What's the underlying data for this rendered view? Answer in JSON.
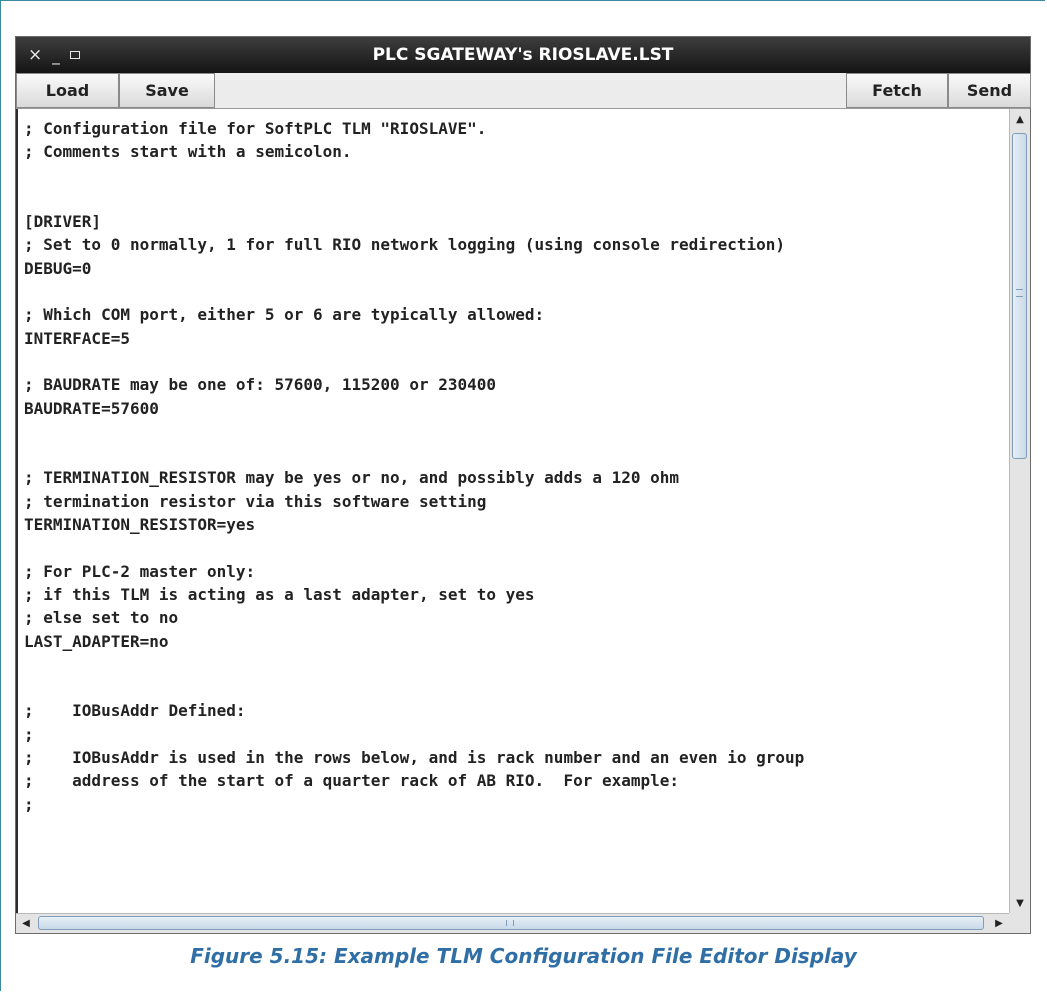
{
  "window": {
    "title": "PLC SGATEWAY's RIOSLAVE.LST",
    "controls": {
      "close": "×",
      "minimize": "_"
    }
  },
  "toolbar": {
    "load_label": "Load",
    "save_label": "Save",
    "fetch_label": "Fetch",
    "send_label": "Send"
  },
  "editor": {
    "content": "; Configuration file for SoftPLC TLM \"RIOSLAVE\".\n; Comments start with a semicolon.\n\n\n[DRIVER]\n; Set to 0 normally, 1 for full RIO network logging (using console redirection)\nDEBUG=0\n\n; Which COM port, either 5 or 6 are typically allowed:\nINTERFACE=5\n\n; BAUDRATE may be one of: 57600, 115200 or 230400\nBAUDRATE=57600\n\n\n; TERMINATION_RESISTOR may be yes or no, and possibly adds a 120 ohm\n; termination resistor via this software setting\nTERMINATION_RESISTOR=yes\n\n; For PLC-2 master only:\n; if this TLM is acting as a last adapter, set to yes\n; else set to no\nLAST_ADAPTER=no\n\n\n;    IOBusAddr Defined:\n;\n;    IOBusAddr is used in the rows below, and is rack number and an even io group\n;    address of the start of a quarter rack of AB RIO.  For example:\n;"
  },
  "scrollbars": {
    "vertical": {
      "up_arrow": "▲",
      "down_arrow": "▼"
    },
    "horizontal": {
      "left_arrow": "◀",
      "right_arrow": "▶"
    }
  },
  "caption": "Figure 5.15: Example TLM Configuration File Editor Display",
  "colors": {
    "titlebar": "#1c1c1c",
    "caption": "#2f6fa6",
    "scroll_thumb": "#c9d9e9"
  }
}
